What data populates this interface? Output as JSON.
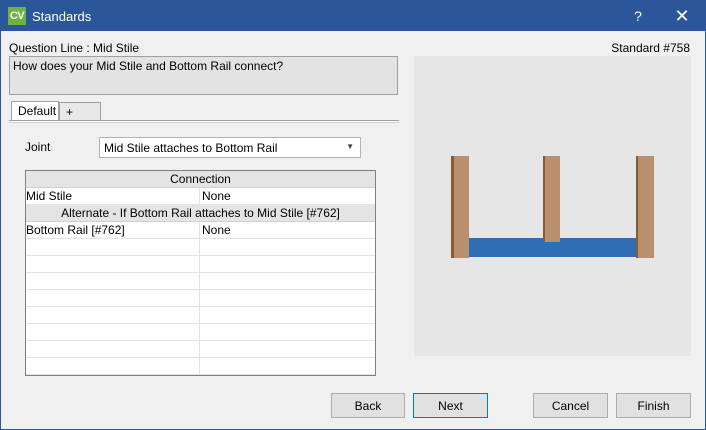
{
  "window": {
    "icon_text": "CV",
    "title": "Standards",
    "help_glyph": "?",
    "close_glyph": "✕"
  },
  "header": {
    "question_line": "Question Line : Mid Stile",
    "standard_number": "Standard #758"
  },
  "question": {
    "text": "How does your Mid Stile and Bottom Rail connect?"
  },
  "tabs": [
    {
      "label": "Default"
    },
    {
      "label": "+"
    }
  ],
  "joint": {
    "label": "Joint",
    "selected": "Mid Stile attaches to Bottom Rail",
    "chevron": "▼"
  },
  "grid": {
    "section1_header": "Connection",
    "row1": {
      "name": "Mid Stile",
      "value": "None"
    },
    "section2_header": "Alternate - If Bottom Rail attaches to Mid Stile [#762]",
    "row2": {
      "name": "Bottom Rail [#762]",
      "value": "None"
    },
    "empty_rows": 8
  },
  "preview": {
    "colors": {
      "stile": "#b8906f",
      "stile_shadow": "#8a5a30",
      "rail": "#2f6db5"
    }
  },
  "buttons": {
    "back": "Back",
    "next": "Next",
    "cancel": "Cancel",
    "finish": "Finish"
  }
}
